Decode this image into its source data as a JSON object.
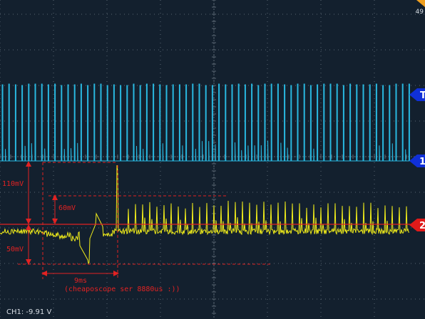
{
  "screen": {
    "top_right_value": "49",
    "status_readout": "CH1: -9.91 V"
  },
  "markers": {
    "trigger_label": "T",
    "ch1_label": "1",
    "ch2_label": "2"
  },
  "annotations": {
    "amp_110": "110mV",
    "amp_60": "60mV",
    "amp_50": "50mV",
    "time_9ms": "9ms",
    "note": "(cheaposcope ser 8880us :))"
  },
  "colors": {
    "background": "#13202e",
    "grid": "#5a6672",
    "ch1_trace": "#29b8e0",
    "ch2_trace": "#f2ee1a",
    "marker": "#1030d8",
    "annotation": "#e22222"
  }
}
